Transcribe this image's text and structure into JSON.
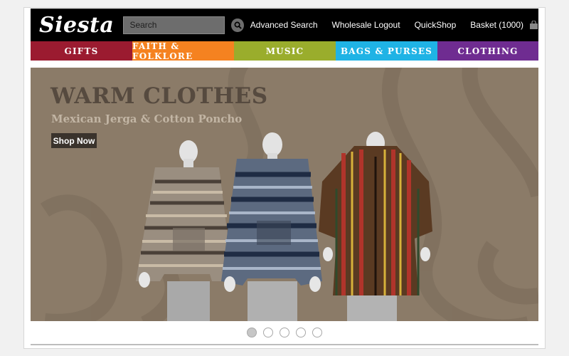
{
  "brand": {
    "logo_text": "Siesta"
  },
  "header": {
    "search_placeholder": "Search",
    "links": {
      "advanced_search": "Advanced Search",
      "wholesale_logout": "Wholesale Logout",
      "quickshop": "QuickShop",
      "basket": "Basket (1000)"
    },
    "icons": {
      "search": "search-icon",
      "basket": "shopping-bag-icon"
    }
  },
  "nav": [
    {
      "label": "GIFTS",
      "color": "#9b1b30"
    },
    {
      "label": "FAITH & FOLKLORE",
      "color": "#f58220"
    },
    {
      "label": "MUSIC",
      "color": "#9aad2c"
    },
    {
      "label": "BAGS & PURSES",
      "color": "#1fb3e5"
    },
    {
      "label": "CLOTHING",
      "color": "#6f2c91"
    }
  ],
  "hero": {
    "title": "WARM CLOTHES",
    "subtitle": "Mexican Jerga & Cotton Poncho",
    "cta": "Shop Now",
    "image": "mannequins-wearing-striped-ponchos"
  },
  "carousel": {
    "count": 5,
    "active": 1
  }
}
